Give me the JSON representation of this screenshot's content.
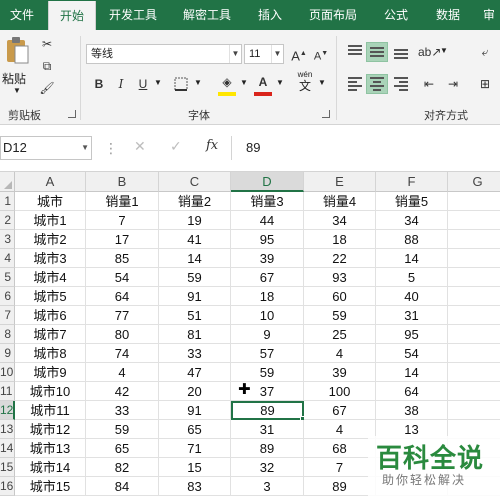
{
  "ribbon": {
    "tabs": [
      "文件",
      "开始",
      "开发工具",
      "解密工具",
      "插入",
      "页面布局",
      "公式",
      "数据",
      "审"
    ],
    "active_tab": "开始",
    "clipboard": {
      "paste_label": "粘贴",
      "group_label": "剪贴板"
    },
    "font": {
      "name": "等线",
      "size": "11",
      "bold": "B",
      "italic": "I",
      "underline": "U",
      "wen": "wén",
      "wen_char": "文",
      "group_label": "字体"
    },
    "alignment": {
      "group_label": "对齐方式"
    },
    "colors": {
      "fill_color": "#ffe600",
      "font_color": "#d9241b"
    }
  },
  "formula_bar": {
    "name_box": "D12",
    "formula": "89",
    "fx": "fx"
  },
  "sheet": {
    "columns": [
      "A",
      "B",
      "C",
      "D",
      "E",
      "F",
      "G"
    ],
    "selected_column": "D",
    "row_numbers": [
      "1",
      "2",
      "3",
      "4",
      "5",
      "6",
      "7",
      "8",
      "9",
      "10",
      "11",
      "12",
      "13",
      "14",
      "15",
      "16"
    ],
    "rows": [
      [
        "城市",
        "销量1",
        "销量2",
        "销量3",
        "销量4",
        "销量5",
        ""
      ],
      [
        "城市1",
        "7",
        "19",
        "44",
        "34",
        "34",
        ""
      ],
      [
        "城市2",
        "17",
        "41",
        "95",
        "18",
        "88",
        ""
      ],
      [
        "城市3",
        "85",
        "14",
        "39",
        "22",
        "14",
        ""
      ],
      [
        "城市4",
        "54",
        "59",
        "67",
        "93",
        "5",
        ""
      ],
      [
        "城市5",
        "64",
        "91",
        "18",
        "60",
        "40",
        ""
      ],
      [
        "城市6",
        "77",
        "51",
        "10",
        "59",
        "31",
        ""
      ],
      [
        "城市7",
        "80",
        "81",
        "9",
        "25",
        "95",
        ""
      ],
      [
        "城市8",
        "74",
        "33",
        "57",
        "4",
        "54",
        ""
      ],
      [
        "城市9",
        "4",
        "47",
        "59",
        "39",
        "14",
        ""
      ],
      [
        "城市10",
        "42",
        "20",
        "37",
        "100",
        "64",
        ""
      ],
      [
        "城市11",
        "33",
        "91",
        "89",
        "67",
        "38",
        ""
      ],
      [
        "城市12",
        "59",
        "65",
        "31",
        "4",
        "13",
        ""
      ],
      [
        "城市13",
        "65",
        "71",
        "89",
        "68",
        "",
        ""
      ],
      [
        "城市14",
        "82",
        "15",
        "32",
        "7",
        "",
        ""
      ],
      [
        "城市15",
        "84",
        "83",
        "3",
        "89",
        "",
        ""
      ]
    ],
    "active_cell": {
      "row": 12,
      "col": "D"
    }
  },
  "watermark": {
    "title": "百科全说",
    "subtitle": "助你轻松解决"
  }
}
